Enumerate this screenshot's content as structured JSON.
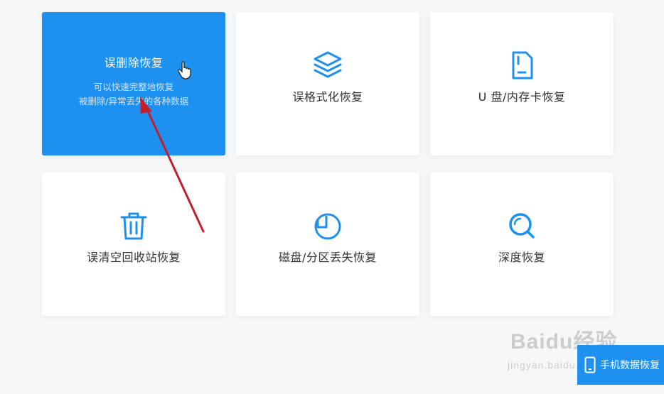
{
  "cards": [
    {
      "title": "误删除恢复",
      "desc_line1": "可以快速完整地恢复",
      "desc_line2": "被删除/异常丢失的各种数据",
      "icon": "selected-state"
    },
    {
      "label": "误格式化恢复",
      "icon": "layers-icon"
    },
    {
      "label": "U 盘/内存卡恢复",
      "icon": "sd-card-icon"
    },
    {
      "label": "误清空回收站恢复",
      "icon": "trash-icon"
    },
    {
      "label": "磁盘/分区丢失恢复",
      "icon": "pie-chart-icon"
    },
    {
      "label": "深度恢复",
      "icon": "search-icon"
    }
  ],
  "phone_button": {
    "label": "手机数据恢复"
  },
  "watermark": {
    "main": "Baidu经验",
    "sub": "jingyan.baidu.com"
  },
  "colors": {
    "accent": "#1e91f0",
    "background": "#f6f7f9",
    "arrow": "#c0202a"
  }
}
